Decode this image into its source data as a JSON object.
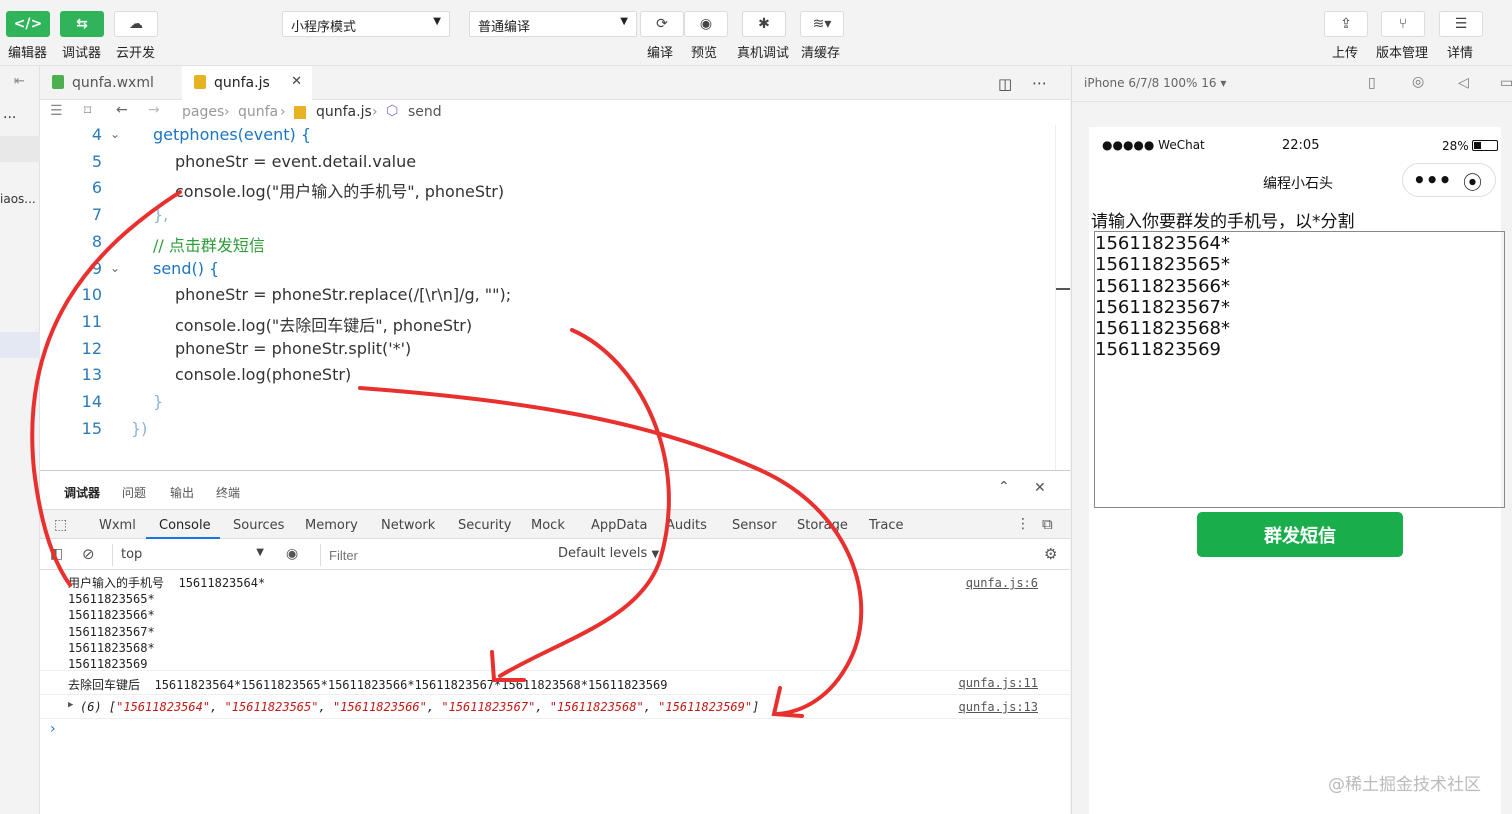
{
  "toolbar": {
    "left_buttons": [
      {
        "icon": "code-icon",
        "label": "编辑器"
      },
      {
        "icon": "debug-icon",
        "label": "调试器"
      },
      {
        "icon": "cloud-icon",
        "label": "云开发"
      }
    ],
    "mode_select": "小程序模式",
    "compile_select": "普通编译",
    "center_buttons": [
      {
        "icon": "refresh-icon",
        "label": "编译"
      },
      {
        "icon": "eye-icon",
        "label": "预览"
      },
      {
        "icon": "bug-icon",
        "label": "真机调试"
      },
      {
        "icon": "layers-icon",
        "label": "清缓存"
      }
    ],
    "right_buttons": [
      {
        "icon": "upload-icon",
        "label": "上传"
      },
      {
        "icon": "branch-icon",
        "label": "版本管理"
      },
      {
        "icon": "menu-icon",
        "label": "详情"
      }
    ]
  },
  "left_strip": {
    "more": "...",
    "file_label": "iaos..."
  },
  "editor": {
    "tabs": [
      {
        "label": "qunfa.wxml",
        "type": "wxml"
      },
      {
        "label": "qunfa.js",
        "type": "js",
        "close": "✕"
      }
    ],
    "breadcrumb": [
      "pages",
      "qunfa",
      "qunfa.js",
      "send"
    ],
    "lines": [
      {
        "num": "4",
        "text": "getphones(event) {"
      },
      {
        "num": "5",
        "text": "phoneStr = event.detail.value"
      },
      {
        "num": "6",
        "text": "console.log(\"用户输入的手机号\", phoneStr)"
      },
      {
        "num": "7",
        "text": "},"
      },
      {
        "num": "8",
        "text": "// 点击群发短信"
      },
      {
        "num": "9",
        "text": "send() {"
      },
      {
        "num": "10",
        "text": "phoneStr = phoneStr.replace(/[\\r\\n]/g, \"\");"
      },
      {
        "num": "11",
        "text": "console.log(\"去除回车键后\", phoneStr)"
      },
      {
        "num": "12",
        "text": "phoneStr = phoneStr.split('*')"
      },
      {
        "num": "13",
        "text": "console.log(phoneStr)"
      },
      {
        "num": "14",
        "text": "}"
      },
      {
        "num": "15",
        "text": "})"
      }
    ]
  },
  "devtools": {
    "top_tabs": [
      "调试器",
      "问题",
      "输出",
      "终端"
    ],
    "panel_tabs": [
      "Wxml",
      "Console",
      "Sources",
      "Memory",
      "Network",
      "Security",
      "Mock",
      "AppData",
      "Audits",
      "Sensor",
      "Storage",
      "Trace"
    ],
    "active_panel": "Console",
    "context": "top",
    "filter_placeholder": "Filter",
    "levels": "Default levels",
    "console": {
      "log1_label": "用户输入的手机号",
      "log1_lines": [
        "15611823564*",
        "15611823565*",
        "15611823566*",
        "15611823567*",
        "15611823568*",
        "15611823569"
      ],
      "log1_src": "qunfa.js:6",
      "log2_label": "去除回车键后",
      "log2_value": "15611823564*15611823565*15611823566*15611823567*15611823568*15611823569",
      "log2_src": "qunfa.js:11",
      "log3_count": "(6)",
      "log3_items": [
        "15611823564",
        "15611823565",
        "15611823566",
        "15611823567",
        "15611823568",
        "15611823569"
      ],
      "log3_src": "qunfa.js:13",
      "prompt": "›"
    }
  },
  "simulator": {
    "device": "iPhone 6/7/8 100% 16 ▾",
    "status": {
      "carrier": "●●●●● WeChat",
      "time": "22:05",
      "battery": "28%"
    },
    "nav_title": "编程小石头",
    "capsule_dots": "•••",
    "prompt": "请输入你要群发的手机号，以*分割",
    "textarea_lines": [
      "15611823564*",
      "15611823565*",
      "15611823566*",
      "15611823567*",
      "15611823568*",
      "15611823569"
    ],
    "send_button": "群发短信"
  },
  "watermark": "@稀土掘金技术社区",
  "accent_colors": {
    "green": "#1aad4c",
    "annotation_red": "#e8302e"
  }
}
